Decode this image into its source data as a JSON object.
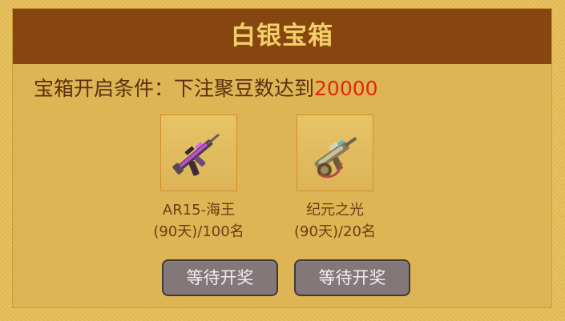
{
  "header": {
    "title": "白银宝箱"
  },
  "condition": {
    "prefix": "宝箱开启条件：下注聚豆数达到",
    "amount": "20000"
  },
  "rewards": [
    {
      "name": "AR15-海王",
      "count": "(90天)/100名",
      "icon": "rifle-icon"
    },
    {
      "name": "纪元之光",
      "count": "(90天)/20名",
      "icon": "heavy-gun-icon"
    }
  ],
  "buttons": {
    "first_label": "等待开奖",
    "second_label": "等待开奖"
  },
  "colors": {
    "title_bar": "#87450f",
    "panel": "#ddb554",
    "highlight": "#e3260f",
    "button": "#847779"
  }
}
